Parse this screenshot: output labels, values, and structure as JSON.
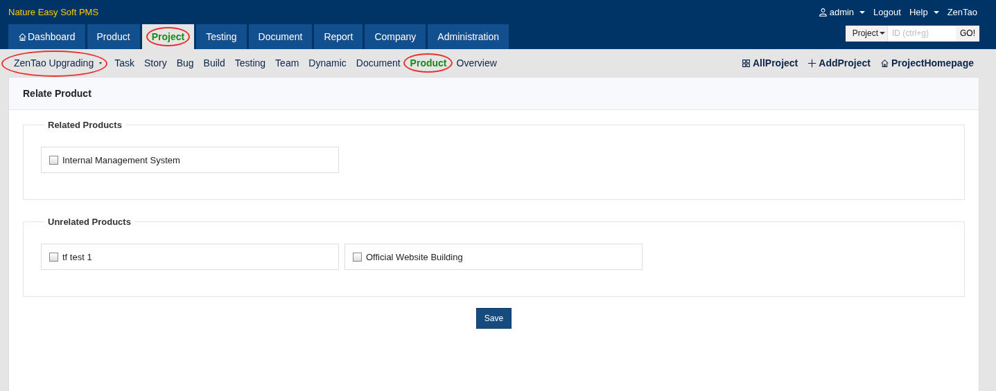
{
  "app_title": "Nature Easy Soft PMS",
  "user_menu": [
    {
      "kind": "user",
      "label": "admin"
    },
    {
      "kind": "link",
      "label": "Logout"
    },
    {
      "kind": "dropdown",
      "label": "Help"
    },
    {
      "kind": "link",
      "label": "ZenTao"
    }
  ],
  "main_tabs": [
    {
      "label": "Dashboard",
      "selected": false,
      "highlighted": false,
      "kind": "home"
    },
    {
      "label": "Product",
      "selected": false,
      "highlighted": false
    },
    {
      "label": "Project",
      "selected": true,
      "highlighted": true
    },
    {
      "label": "Testing",
      "selected": false,
      "highlighted": false
    },
    {
      "label": "Document",
      "selected": false,
      "highlighted": false
    },
    {
      "label": "Report",
      "selected": false,
      "highlighted": false
    },
    {
      "label": "Company",
      "selected": false,
      "highlighted": false
    },
    {
      "label": "Administration",
      "selected": false,
      "highlighted": false
    }
  ],
  "quick_search": {
    "scope": "Project",
    "placeholder": "ID (ctrl+g)",
    "button": "GO!"
  },
  "project_switcher": {
    "label": "ZenTao Upgrading",
    "highlighted": true
  },
  "sub_nav": [
    {
      "label": "Task",
      "selected": false,
      "highlighted": false
    },
    {
      "label": "Story",
      "selected": false,
      "highlighted": false
    },
    {
      "label": "Bug",
      "selected": false,
      "highlighted": false
    },
    {
      "label": "Build",
      "selected": false,
      "highlighted": false
    },
    {
      "label": "Testing",
      "selected": false,
      "highlighted": false
    },
    {
      "label": "Team",
      "selected": false,
      "highlighted": false
    },
    {
      "label": "Dynamic",
      "selected": false,
      "highlighted": false
    },
    {
      "label": "Document",
      "selected": false,
      "highlighted": false
    },
    {
      "label": "Product",
      "selected": true,
      "highlighted": true
    },
    {
      "label": "Overview",
      "selected": false,
      "highlighted": false
    }
  ],
  "actions": [
    {
      "label": "AllProject",
      "kind": "grid"
    },
    {
      "label": "AddProject",
      "kind": "plus"
    },
    {
      "label": "ProjectHomepage",
      "kind": "home"
    }
  ],
  "panel": {
    "title": "Relate Product",
    "groups": [
      {
        "legend": "Related Products",
        "items": [
          {
            "label": "Internal Management System",
            "checked": false
          }
        ]
      },
      {
        "legend": "Unrelated Products",
        "items": [
          {
            "label": "tf test 1",
            "checked": false
          },
          {
            "label": "Official Website Building",
            "checked": false
          }
        ]
      }
    ],
    "save_button": "Save"
  }
}
